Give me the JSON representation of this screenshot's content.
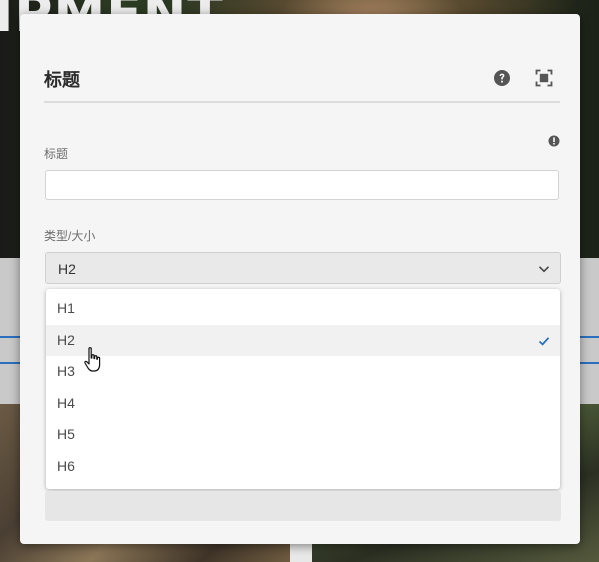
{
  "background": {
    "heading_fragment": "IPMENT"
  },
  "dialog": {
    "title": "标题",
    "help_icon": "help-circle-icon",
    "fullscreen_icon": "fullscreen-icon",
    "info_icon": "info-icon",
    "fields": {
      "title_label": "标题",
      "title_value": "",
      "type_label": "类型/大小",
      "type_selected": "H2"
    },
    "dropdown": {
      "options": [
        "H1",
        "H2",
        "H3",
        "H4",
        "H5",
        "H6"
      ],
      "selected_index": 1
    }
  },
  "colors": {
    "accent": "#2a6fc0",
    "dialog_bg": "#f5f5f5",
    "check": "#2a6fc0"
  }
}
